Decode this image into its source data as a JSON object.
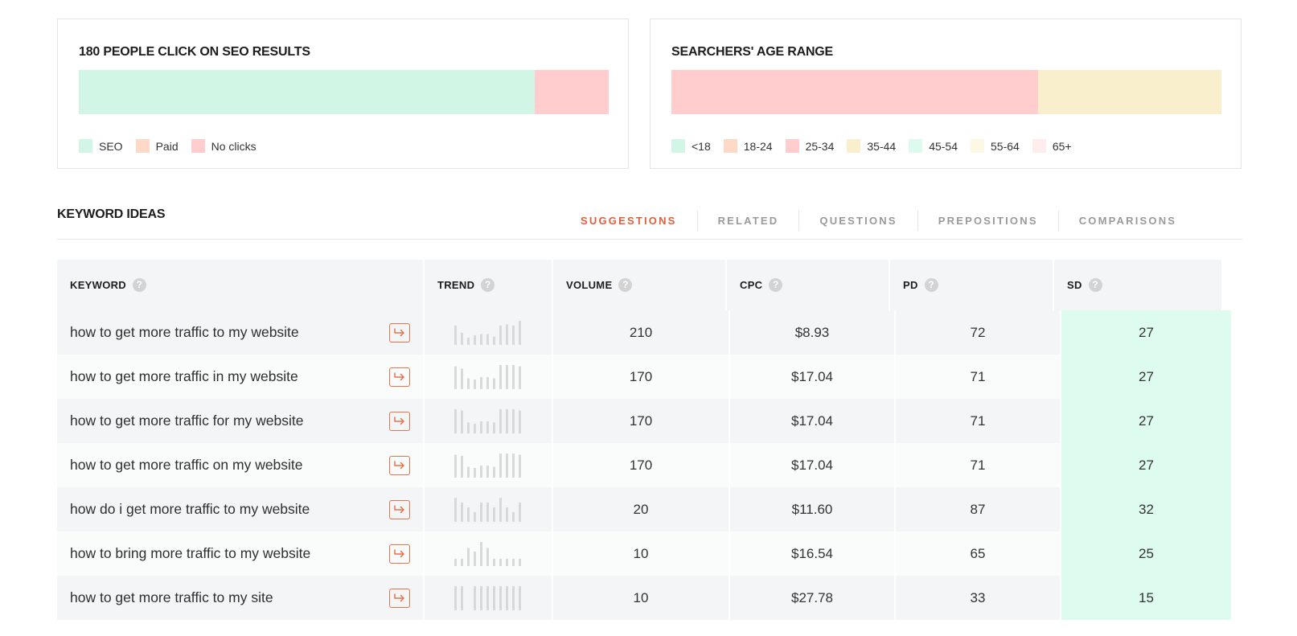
{
  "seo_card": {
    "title": "180 PEOPLE CLICK ON SEO RESULTS",
    "segments": [
      {
        "label": "SEO",
        "fraction": 0.86,
        "color": "#d1f6e5"
      },
      {
        "label": "No clicks",
        "fraction": 0.14,
        "color": "#ffcdcd"
      }
    ],
    "legend": [
      {
        "label": "SEO",
        "color": "#d1f6e5"
      },
      {
        "label": "Paid",
        "color": "#ffd9c8"
      },
      {
        "label": "No clicks",
        "color": "#ffcdcd"
      }
    ]
  },
  "age_card": {
    "title": "SEARCHERS' AGE RANGE",
    "segments": [
      {
        "label": "25-34",
        "fraction": 0.667,
        "color": "#ffcdcd"
      },
      {
        "label": "35-44",
        "fraction": 0.333,
        "color": "#f9efcc"
      }
    ],
    "legend": [
      {
        "label": "<18",
        "color": "#d1f6e5"
      },
      {
        "label": "18-24",
        "color": "#ffd9c8"
      },
      {
        "label": "25-34",
        "color": "#ffcdcd"
      },
      {
        "label": "35-44",
        "color": "#f9efcc"
      },
      {
        "label": "45-54",
        "color": "#dcfaee"
      },
      {
        "label": "55-64",
        "color": "#fdf8e3"
      },
      {
        "label": "65+",
        "color": "#ffecec"
      }
    ]
  },
  "keyword_ideas": {
    "title": "KEYWORD IDEAS",
    "tabs": [
      {
        "label": "SUGGESTIONS",
        "active": true
      },
      {
        "label": "RELATED",
        "active": false
      },
      {
        "label": "QUESTIONS",
        "active": false
      },
      {
        "label": "PREPOSITIONS",
        "active": false
      },
      {
        "label": "COMPARISONS",
        "active": false
      }
    ]
  },
  "table": {
    "columns": [
      "KEYWORD",
      "TREND",
      "VOLUME",
      "CPC",
      "PD",
      "SD"
    ],
    "help_icon": "?",
    "rows": [
      {
        "keyword": "how to get more traffic to my website",
        "trend": [
          0.8,
          0.5,
          0.3,
          0.4,
          0.45,
          0.45,
          0.35,
          0.8,
          0.85,
          0.8,
          1.0
        ],
        "volume": "210",
        "cpc": "$8.93",
        "pd": "72",
        "sd": "27"
      },
      {
        "keyword": "how to get more traffic in my website",
        "trend": [
          0.95,
          0.85,
          0.45,
          0.4,
          0.5,
          0.5,
          0.45,
          1.0,
          1.0,
          1.0,
          0.95
        ],
        "volume": "170",
        "cpc": "$17.04",
        "pd": "71",
        "sd": "27"
      },
      {
        "keyword": "how to get more traffic for my website",
        "trend": [
          1.0,
          0.95,
          0.45,
          0.4,
          0.5,
          0.5,
          0.45,
          1.0,
          1.0,
          1.0,
          0.95
        ],
        "volume": "170",
        "cpc": "$17.04",
        "pd": "71",
        "sd": "27"
      },
      {
        "keyword": "how to get more traffic on my website",
        "trend": [
          0.95,
          0.9,
          0.45,
          0.4,
          0.5,
          0.5,
          0.45,
          1.0,
          1.0,
          1.0,
          0.95
        ],
        "volume": "170",
        "cpc": "$17.04",
        "pd": "71",
        "sd": "27"
      },
      {
        "keyword": "how do i get more traffic to my website",
        "trend": [
          1.0,
          0.8,
          0.6,
          0.4,
          0.8,
          0.8,
          0.6,
          1.0,
          0.6,
          0.4,
          0.8
        ],
        "volume": "20",
        "cpc": "$11.60",
        "pd": "87",
        "sd": "32"
      },
      {
        "keyword": "how to bring more traffic to my website",
        "trend": [
          0.3,
          0.3,
          0.75,
          0.6,
          1.0,
          0.75,
          0.3,
          0.3,
          0.3,
          0.3,
          0.3
        ],
        "volume": "10",
        "cpc": "$16.54",
        "pd": "65",
        "sd": "25"
      },
      {
        "keyword": "how to get more traffic to my site",
        "trend": [
          1.0,
          1.0,
          0,
          1.0,
          1.0,
          1.0,
          1.0,
          1.0,
          1.0,
          1.0,
          1.0
        ],
        "volume": "10",
        "cpc": "$27.78",
        "pd": "33",
        "sd": "15"
      }
    ]
  },
  "colors": {
    "accent": "#e45e3b",
    "button_border": "#e8734c",
    "sd_cell": "#ddfcef",
    "trend_bar": "#d9d9d9"
  },
  "icons": {
    "help": "help-circle-icon",
    "go": "arrow-turn-right-icon"
  }
}
